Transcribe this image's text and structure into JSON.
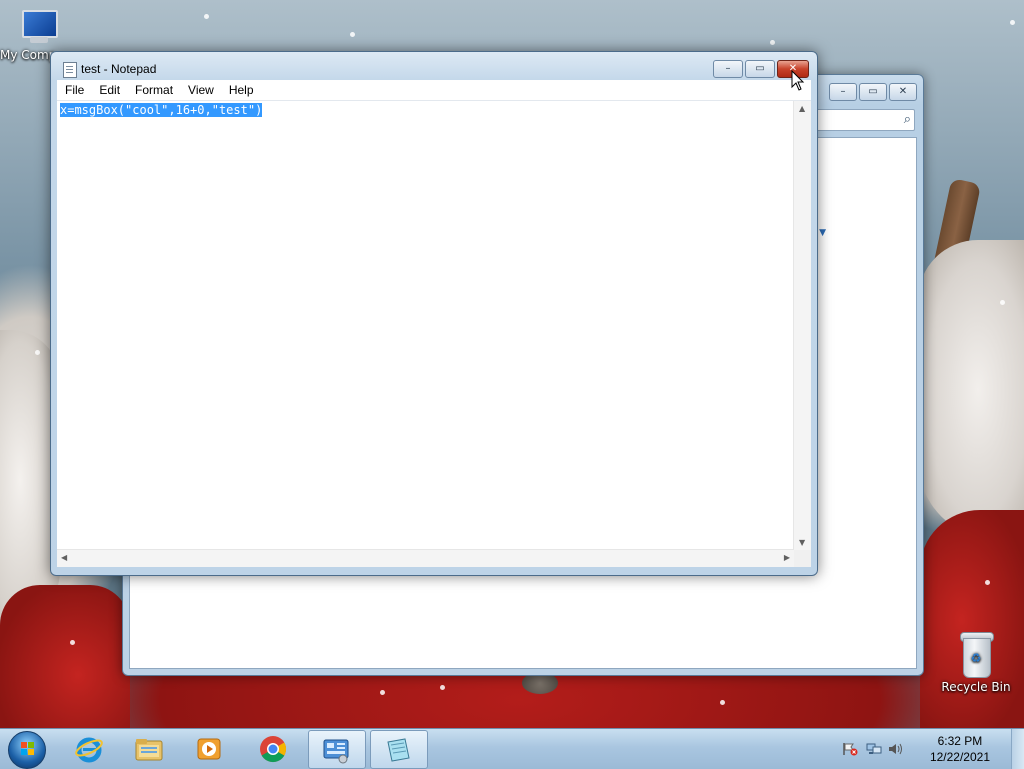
{
  "desktop": {
    "icons": [
      {
        "label": "My Comp"
      },
      {
        "label": "Recycle Bin"
      }
    ]
  },
  "notepad": {
    "title": "test - Notepad",
    "menu": [
      "File",
      "Edit",
      "Format",
      "View",
      "Help"
    ],
    "content": "x=msgBox(\"cool\",16+0,\"test\")",
    "selection": "all"
  },
  "explorer": {
    "title": ""
  },
  "caption_buttons": {
    "minimize": "–",
    "maximize": "▭",
    "close": "✕"
  },
  "taskbar": {
    "apps": [
      {
        "icon": "internet-explorer-icon"
      },
      {
        "icon": "file-explorer-icon"
      },
      {
        "icon": "media-player-icon"
      },
      {
        "icon": "chrome-icon"
      },
      {
        "icon": "control-panel-icon",
        "active": true
      },
      {
        "icon": "notepad-icon",
        "active": true
      }
    ],
    "clock": {
      "time": "6:32 PM",
      "date": "12/22/2021"
    }
  },
  "colors": {
    "selection": "#3399ff",
    "close_button": "#c7422a",
    "taskbar": "#a9c6e0"
  }
}
